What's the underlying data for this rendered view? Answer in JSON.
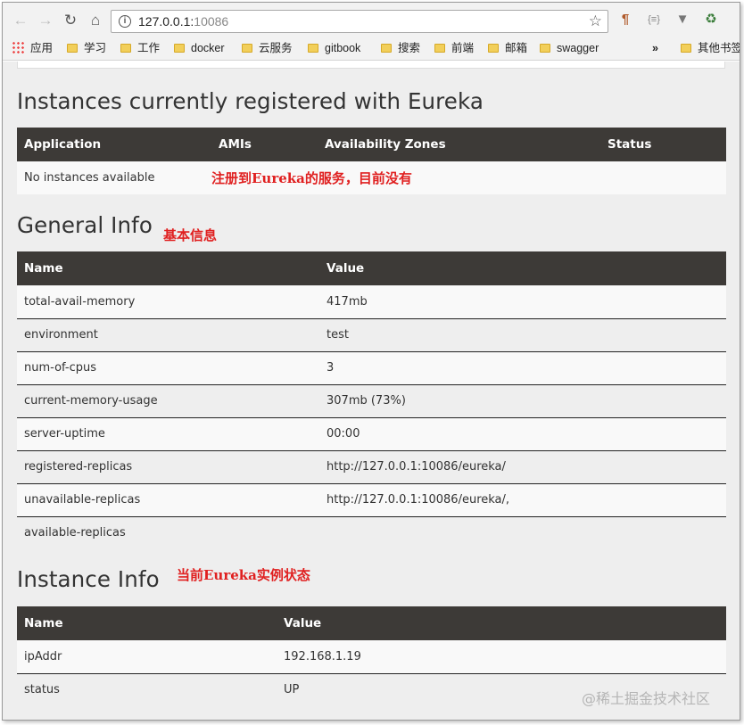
{
  "browser": {
    "url_host": "127.0.0.1:",
    "url_port": "10086",
    "bookmarks": [
      {
        "label": "应用",
        "kind": "apps"
      },
      {
        "label": "学习",
        "kind": "folder"
      },
      {
        "label": "工作",
        "kind": "folder"
      },
      {
        "label": "docker",
        "kind": "folder"
      },
      {
        "label": "云服务",
        "kind": "folder"
      },
      {
        "label": "gitbook",
        "kind": "folder"
      },
      {
        "label": "搜索",
        "kind": "folder"
      },
      {
        "label": "前端",
        "kind": "folder"
      },
      {
        "label": "邮箱",
        "kind": "folder"
      },
      {
        "label": "swagger",
        "kind": "folder"
      }
    ],
    "more_label": "»",
    "other_bookmarks": "其他书签"
  },
  "instances": {
    "title": "Instances currently registered with Eureka",
    "columns": [
      "Application",
      "AMIs",
      "Availability Zones",
      "Status"
    ],
    "empty_text": "No instances available",
    "annotation": "注册到Eureka的服务，目前没有"
  },
  "general": {
    "title": "General Info",
    "annotation": "基本信息",
    "columns": [
      "Name",
      "Value"
    ],
    "rows": [
      [
        "total-avail-memory",
        "417mb"
      ],
      [
        "environment",
        "test"
      ],
      [
        "num-of-cpus",
        "3"
      ],
      [
        "current-memory-usage",
        "307mb (73%)"
      ],
      [
        "server-uptime",
        "00:00"
      ],
      [
        "registered-replicas",
        "http://127.0.0.1:10086/eureka/"
      ],
      [
        "unavailable-replicas",
        "http://127.0.0.1:10086/eureka/,"
      ],
      [
        "available-replicas",
        ""
      ]
    ]
  },
  "instance_info": {
    "title": "Instance Info",
    "annotation": "当前Eureka实例状态",
    "columns": [
      "Name",
      "Value"
    ],
    "rows": [
      [
        "ipAddr",
        "192.168.1.19"
      ],
      [
        "status",
        "UP"
      ]
    ]
  },
  "watermark": "@稀土掘金技术社区",
  "colors": {
    "table_header": "#3d3a37",
    "annotation": "#e02020",
    "page_bg": "#eeeeee"
  }
}
